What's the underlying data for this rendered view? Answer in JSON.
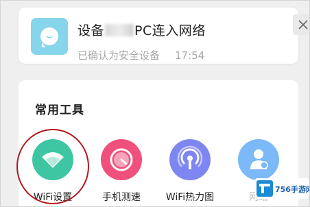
{
  "notification": {
    "title_prefix": "设备",
    "title_suffix": "PC连入网络",
    "subtitle": "已确认为安全设备",
    "time": "17:54",
    "icon": "chat-bubble-icon",
    "icon_color": "#87d5ea"
  },
  "tools_section": {
    "title": "常用工具",
    "items": [
      {
        "label": "WiFi设置",
        "icon": "wifi-icon",
        "color": "#3dc6a1"
      },
      {
        "label": "手机测速",
        "icon": "speedometer-icon",
        "color": "#f0507c"
      },
      {
        "label": "WiFi热力图",
        "icon": "signal-tower-icon",
        "color": "#7e86f2"
      },
      {
        "label": "网络",
        "icon": "user-shield-icon",
        "color": "#7bb9f8"
      }
    ]
  },
  "watermark": {
    "text": "756手游网"
  },
  "colors": {
    "background": "#efefef",
    "highlight": "#b4171d"
  }
}
